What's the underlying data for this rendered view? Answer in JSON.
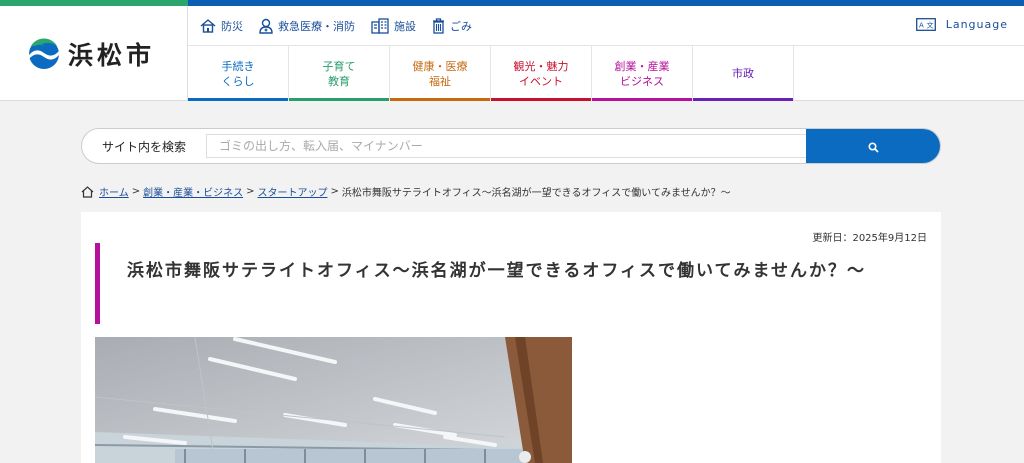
{
  "site": {
    "logo_text": "浜松市"
  },
  "util": {
    "items": [
      {
        "label": "防災",
        "icon": "house-icon"
      },
      {
        "label": "救急医療・消防",
        "icon": "doctor-icon"
      },
      {
        "label": "施設",
        "icon": "building-icon"
      },
      {
        "label": "ごみ",
        "icon": "trash-icon"
      }
    ],
    "language_label": "Language"
  },
  "nav": {
    "items": [
      {
        "line1": "手続き",
        "line2": "くらし",
        "color": "#0a6bc1"
      },
      {
        "line1": "子育て",
        "line2": "教育",
        "color": "#2a9d6c"
      },
      {
        "line1": "健康・医療",
        "line2": "福祉",
        "color": "#c66a10"
      },
      {
        "line1": "観光・魅力",
        "line2": "イベント",
        "color": "#c8102e"
      },
      {
        "line1": "創業・産業",
        "line2": "ビジネス",
        "color": "#b5119a"
      },
      {
        "line1": "市政",
        "line2": "",
        "color": "#6a1fb5"
      }
    ]
  },
  "search": {
    "label": "サイト内を検索",
    "placeholder": "ゴミの出し方、転入届、マイナンバー"
  },
  "breadcrumb": {
    "home": "ホーム",
    "crumb1": "創業・産業・ビジネス",
    "crumb2": "スタートアップ",
    "current": "浜松市舞阪サテライトオフィス～浜名湖が一望できるオフィスで働いてみませんか？～",
    "separator": ">"
  },
  "page": {
    "updated": "更新日：2025年9月12日",
    "title": "浜松市舞阪サテライトオフィス～浜名湖が一望できるオフィスで働いてみませんか？～"
  },
  "colors": {
    "brand_green": "#2ba66d",
    "brand_blue": "#0a5fb4",
    "search_button": "#0a6bc1",
    "title_accent": "#b5119a"
  }
}
